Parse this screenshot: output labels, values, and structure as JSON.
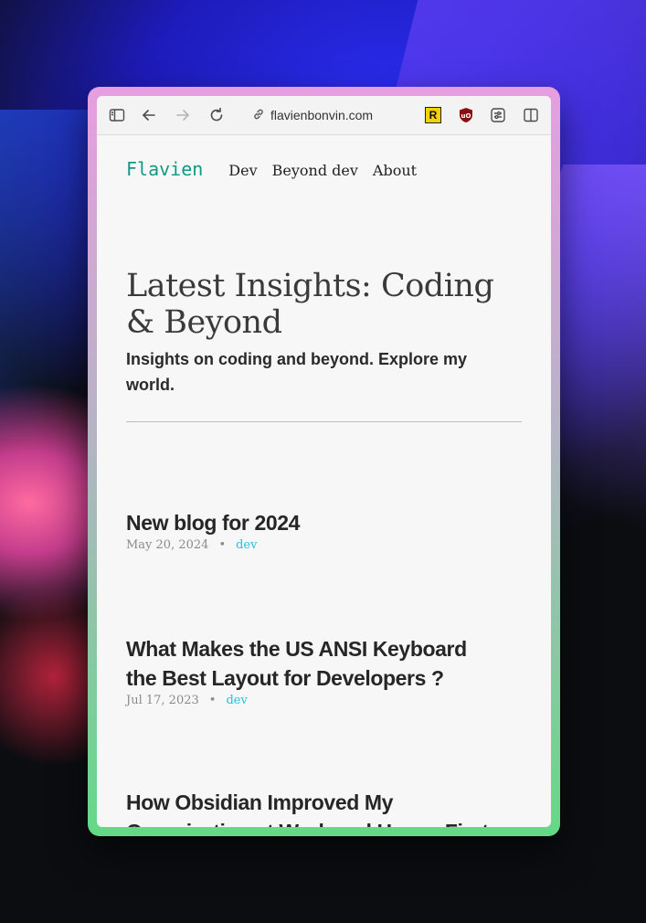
{
  "browser": {
    "url": "flavienbonvin.com",
    "extensions": [
      "R",
      "uBlock"
    ]
  },
  "site": {
    "logo": "Flavien",
    "nav": [
      "Dev",
      "Beyond dev",
      "About"
    ]
  },
  "hero": {
    "title": "Latest Insights: Coding & Beyond",
    "subtitle": "Insights on coding and beyond. Explore my world."
  },
  "posts": [
    {
      "title": "New blog for 2024",
      "date": "May 20, 2024",
      "tag": "dev"
    },
    {
      "title": "What Makes the US ANSI Keyboard the Best Layout for Developers ?",
      "date": "Jul 17, 2023",
      "tag": "dev"
    },
    {
      "title": "How Obsidian Improved My Organization at Work and Home. First Month Review",
      "date": "",
      "tag": ""
    }
  ],
  "colors": {
    "logo": "#0f9a86",
    "tag": "#1ec3e0",
    "frame_top": "#e79ee0",
    "frame_bottom": "#64d987"
  }
}
